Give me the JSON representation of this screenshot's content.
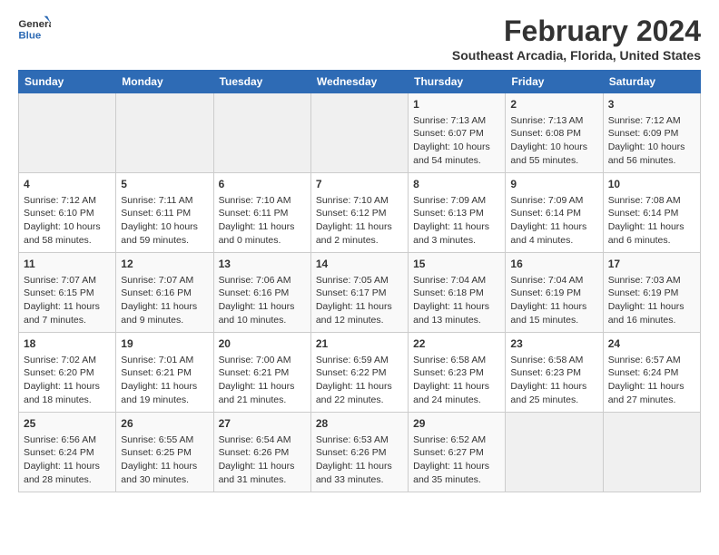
{
  "header": {
    "logo_line1": "General",
    "logo_line2": "Blue",
    "title": "February 2024",
    "subtitle": "Southeast Arcadia, Florida, United States"
  },
  "days_of_week": [
    "Sunday",
    "Monday",
    "Tuesday",
    "Wednesday",
    "Thursday",
    "Friday",
    "Saturday"
  ],
  "weeks": [
    [
      {
        "day": "",
        "info": ""
      },
      {
        "day": "",
        "info": ""
      },
      {
        "day": "",
        "info": ""
      },
      {
        "day": "",
        "info": ""
      },
      {
        "day": "1",
        "info": "Sunrise: 7:13 AM\nSunset: 6:07 PM\nDaylight: 10 hours\nand 54 minutes."
      },
      {
        "day": "2",
        "info": "Sunrise: 7:13 AM\nSunset: 6:08 PM\nDaylight: 10 hours\nand 55 minutes."
      },
      {
        "day": "3",
        "info": "Sunrise: 7:12 AM\nSunset: 6:09 PM\nDaylight: 10 hours\nand 56 minutes."
      }
    ],
    [
      {
        "day": "4",
        "info": "Sunrise: 7:12 AM\nSunset: 6:10 PM\nDaylight: 10 hours\nand 58 minutes."
      },
      {
        "day": "5",
        "info": "Sunrise: 7:11 AM\nSunset: 6:11 PM\nDaylight: 10 hours\nand 59 minutes."
      },
      {
        "day": "6",
        "info": "Sunrise: 7:10 AM\nSunset: 6:11 PM\nDaylight: 11 hours\nand 0 minutes."
      },
      {
        "day": "7",
        "info": "Sunrise: 7:10 AM\nSunset: 6:12 PM\nDaylight: 11 hours\nand 2 minutes."
      },
      {
        "day": "8",
        "info": "Sunrise: 7:09 AM\nSunset: 6:13 PM\nDaylight: 11 hours\nand 3 minutes."
      },
      {
        "day": "9",
        "info": "Sunrise: 7:09 AM\nSunset: 6:14 PM\nDaylight: 11 hours\nand 4 minutes."
      },
      {
        "day": "10",
        "info": "Sunrise: 7:08 AM\nSunset: 6:14 PM\nDaylight: 11 hours\nand 6 minutes."
      }
    ],
    [
      {
        "day": "11",
        "info": "Sunrise: 7:07 AM\nSunset: 6:15 PM\nDaylight: 11 hours\nand 7 minutes."
      },
      {
        "day": "12",
        "info": "Sunrise: 7:07 AM\nSunset: 6:16 PM\nDaylight: 11 hours\nand 9 minutes."
      },
      {
        "day": "13",
        "info": "Sunrise: 7:06 AM\nSunset: 6:16 PM\nDaylight: 11 hours\nand 10 minutes."
      },
      {
        "day": "14",
        "info": "Sunrise: 7:05 AM\nSunset: 6:17 PM\nDaylight: 11 hours\nand 12 minutes."
      },
      {
        "day": "15",
        "info": "Sunrise: 7:04 AM\nSunset: 6:18 PM\nDaylight: 11 hours\nand 13 minutes."
      },
      {
        "day": "16",
        "info": "Sunrise: 7:04 AM\nSunset: 6:19 PM\nDaylight: 11 hours\nand 15 minutes."
      },
      {
        "day": "17",
        "info": "Sunrise: 7:03 AM\nSunset: 6:19 PM\nDaylight: 11 hours\nand 16 minutes."
      }
    ],
    [
      {
        "day": "18",
        "info": "Sunrise: 7:02 AM\nSunset: 6:20 PM\nDaylight: 11 hours\nand 18 minutes."
      },
      {
        "day": "19",
        "info": "Sunrise: 7:01 AM\nSunset: 6:21 PM\nDaylight: 11 hours\nand 19 minutes."
      },
      {
        "day": "20",
        "info": "Sunrise: 7:00 AM\nSunset: 6:21 PM\nDaylight: 11 hours\nand 21 minutes."
      },
      {
        "day": "21",
        "info": "Sunrise: 6:59 AM\nSunset: 6:22 PM\nDaylight: 11 hours\nand 22 minutes."
      },
      {
        "day": "22",
        "info": "Sunrise: 6:58 AM\nSunset: 6:23 PM\nDaylight: 11 hours\nand 24 minutes."
      },
      {
        "day": "23",
        "info": "Sunrise: 6:58 AM\nSunset: 6:23 PM\nDaylight: 11 hours\nand 25 minutes."
      },
      {
        "day": "24",
        "info": "Sunrise: 6:57 AM\nSunset: 6:24 PM\nDaylight: 11 hours\nand 27 minutes."
      }
    ],
    [
      {
        "day": "25",
        "info": "Sunrise: 6:56 AM\nSunset: 6:24 PM\nDaylight: 11 hours\nand 28 minutes."
      },
      {
        "day": "26",
        "info": "Sunrise: 6:55 AM\nSunset: 6:25 PM\nDaylight: 11 hours\nand 30 minutes."
      },
      {
        "day": "27",
        "info": "Sunrise: 6:54 AM\nSunset: 6:26 PM\nDaylight: 11 hours\nand 31 minutes."
      },
      {
        "day": "28",
        "info": "Sunrise: 6:53 AM\nSunset: 6:26 PM\nDaylight: 11 hours\nand 33 minutes."
      },
      {
        "day": "29",
        "info": "Sunrise: 6:52 AM\nSunset: 6:27 PM\nDaylight: 11 hours\nand 35 minutes."
      },
      {
        "day": "",
        "info": ""
      },
      {
        "day": "",
        "info": ""
      }
    ]
  ]
}
